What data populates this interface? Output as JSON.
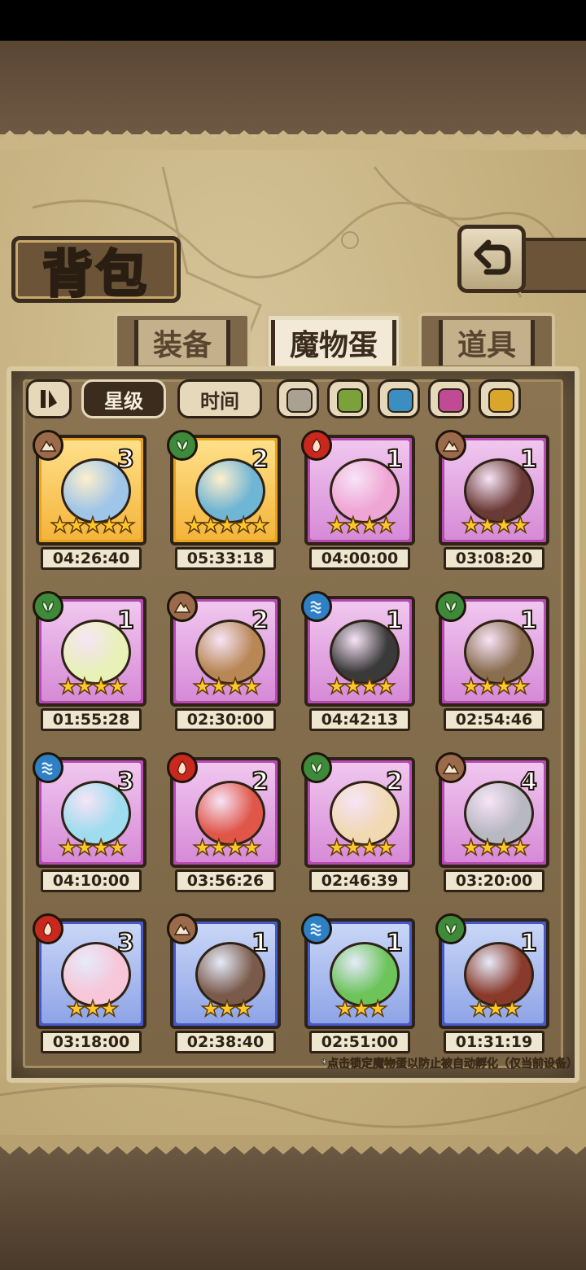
{
  "title": "背包",
  "tabs": [
    {
      "label": "装备",
      "active": false
    },
    {
      "label": "魔物蛋",
      "active": true
    },
    {
      "label": "道具",
      "active": false
    }
  ],
  "sort": {
    "toggle_icon": "sort-toggle-icon",
    "star_label": "星级",
    "time_label": "时间"
  },
  "color_filters": [
    {
      "name": "gray",
      "color": "#a9a293"
    },
    {
      "name": "green",
      "color": "#7aa13a"
    },
    {
      "name": "blue",
      "color": "#3b8fc0"
    },
    {
      "name": "pink",
      "color": "#c14a95"
    },
    {
      "name": "yellow",
      "color": "#d9a52a"
    }
  ],
  "eggs": [
    {
      "count": "3",
      "stars": "★★★★★",
      "timer": "04:26:40",
      "element": "earth",
      "rarity": "gold",
      "tint": "#9fc6e8"
    },
    {
      "count": "2",
      "stars": "★★★★★",
      "timer": "05:33:18",
      "element": "leaf",
      "rarity": "gold",
      "tint": "#6fb5d4"
    },
    {
      "count": "1",
      "stars": "★★★★",
      "timer": "04:00:00",
      "element": "fire",
      "rarity": "purple",
      "tint": "#f0a6d4"
    },
    {
      "count": "1",
      "stars": "★★★★",
      "timer": "03:08:20",
      "element": "earth",
      "rarity": "purple",
      "tint": "#6a3a36"
    },
    {
      "count": "1",
      "stars": "★★★★",
      "timer": "01:55:28",
      "element": "leaf",
      "rarity": "purple",
      "tint": "#e8f1b8"
    },
    {
      "count": "2",
      "stars": "★★★★",
      "timer": "02:30:00",
      "element": "earth",
      "rarity": "purple",
      "tint": "#b98755"
    },
    {
      "count": "1",
      "stars": "★★★★",
      "timer": "04:42:13",
      "element": "water",
      "rarity": "purple",
      "tint": "#3a3a3a"
    },
    {
      "count": "1",
      "stars": "★★★★",
      "timer": "02:54:46",
      "element": "leaf",
      "rarity": "purple",
      "tint": "#8a6e50"
    },
    {
      "count": "3",
      "stars": "★★★★",
      "timer": "04:10:00",
      "element": "water",
      "rarity": "purple",
      "tint": "#9fdcef"
    },
    {
      "count": "2",
      "stars": "★★★★",
      "timer": "03:56:26",
      "element": "fire",
      "rarity": "purple",
      "tint": "#e0574a"
    },
    {
      "count": "2",
      "stars": "★★★★",
      "timer": "02:46:39",
      "element": "leaf",
      "rarity": "purple",
      "tint": "#f1d9b4"
    },
    {
      "count": "4",
      "stars": "★★★★",
      "timer": "03:20:00",
      "element": "earth",
      "rarity": "purple",
      "tint": "#b8b8c2"
    },
    {
      "count": "3",
      "stars": "★★★",
      "timer": "03:18:00",
      "element": "fire",
      "rarity": "blue",
      "tint": "#f7c6d8"
    },
    {
      "count": "1",
      "stars": "★★★",
      "timer": "02:38:40",
      "element": "earth",
      "rarity": "blue",
      "tint": "#7a5a4a"
    },
    {
      "count": "1",
      "stars": "★★★",
      "timer": "02:51:00",
      "element": "water",
      "rarity": "blue",
      "tint": "#6cc45a"
    },
    {
      "count": "1",
      "stars": "★★★",
      "timer": "01:31:19",
      "element": "leaf",
      "rarity": "blue",
      "tint": "#8a3a2a"
    }
  ],
  "footer_note": "*点击锁定魔物蛋以防止被自动孵化（仅当前设备）"
}
